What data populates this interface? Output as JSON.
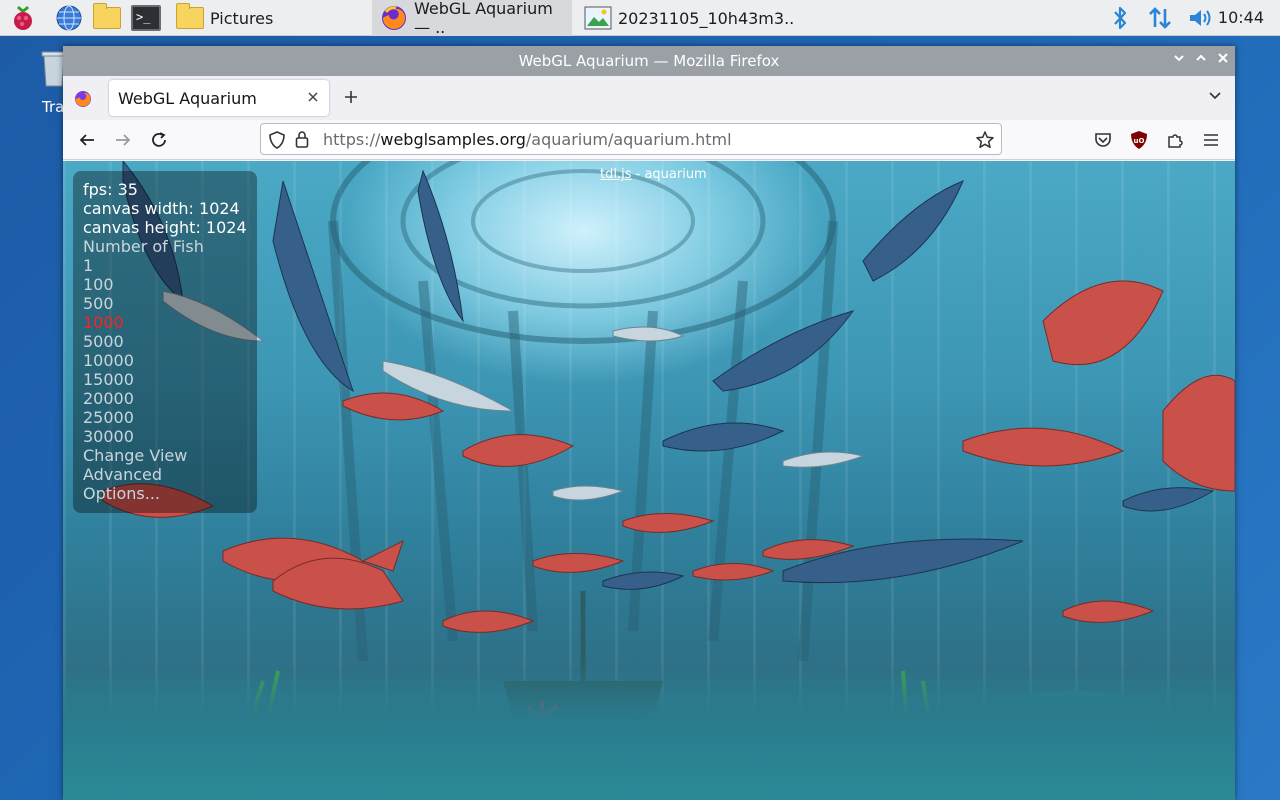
{
  "taskbar": {
    "items": [
      {
        "label": "Pictures"
      },
      {
        "label": "WebGL Aquarium — .."
      },
      {
        "label": "20231105_10h43m3.."
      }
    ],
    "clock": "10:44"
  },
  "desktop": {
    "trash_label": "Tra"
  },
  "window": {
    "title": "WebGL Aquarium — Mozilla Firefox",
    "tab_title": "WebGL Aquarium",
    "url_prefix": "https://",
    "url_domain": "webglsamples.org",
    "url_path": "/aquarium/aquarium.html"
  },
  "page": {
    "header_link": "tdl.js",
    "header_text": " - aquarium",
    "fps": "fps: 35",
    "canvas_width": "canvas width: 1024",
    "canvas_height": "canvas height: 1024",
    "fish_heading": "Number of Fish",
    "fish_options": [
      "1",
      "100",
      "500",
      "1000",
      "5000",
      "10000",
      "15000",
      "20000",
      "25000",
      "30000"
    ],
    "selected_option": "1000",
    "change_view": "Change View",
    "advanced": "Advanced",
    "options": "Options..."
  },
  "colors": {
    "selected": "#ff2020",
    "taskbar_bg": "#edeef0",
    "titlebar_bg": "#9aa0a6"
  }
}
